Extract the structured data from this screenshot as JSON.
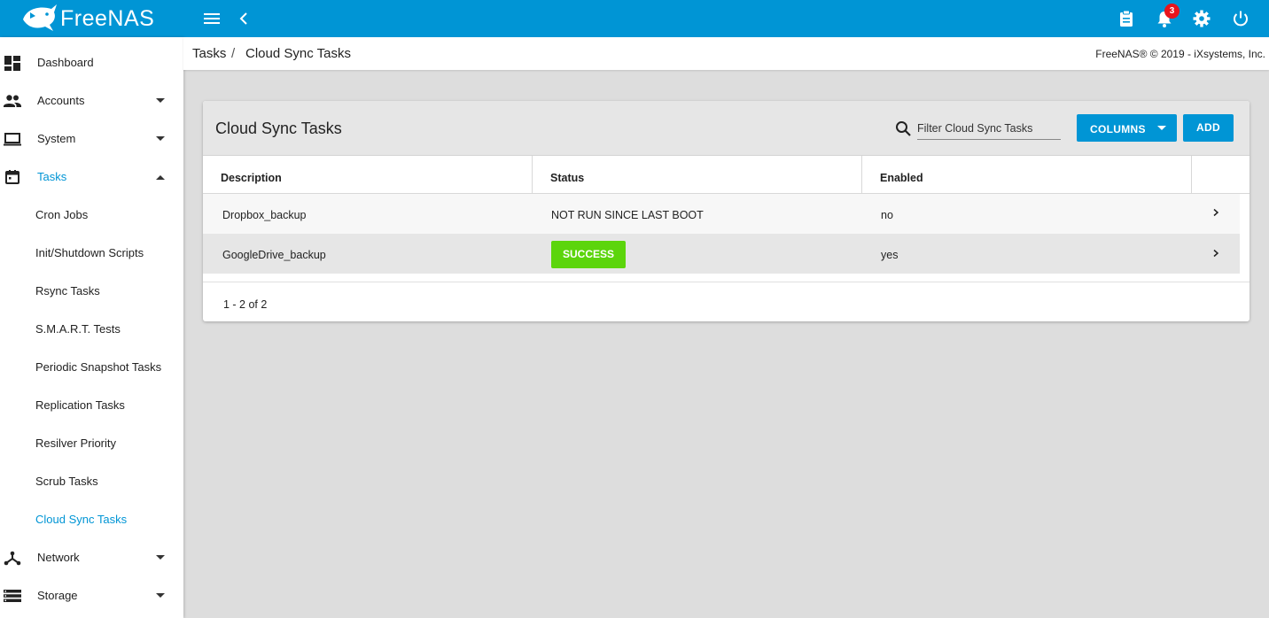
{
  "app": {
    "logo_text": "FreeNAS",
    "notification_count": "3",
    "accent_color": "#0095d5"
  },
  "sidebar": {
    "items": [
      {
        "label": "Dashboard",
        "icon": "dashboard-icon"
      },
      {
        "label": "Accounts",
        "icon": "people-icon"
      },
      {
        "label": "System",
        "icon": "laptop-icon"
      },
      {
        "label": "Tasks",
        "icon": "calendar-icon"
      },
      {
        "label": "Network",
        "icon": "network-icon"
      },
      {
        "label": "Storage",
        "icon": "storage-icon"
      }
    ],
    "task_subitems": [
      "Cron Jobs",
      "Init/Shutdown Scripts",
      "Rsync Tasks",
      "S.M.A.R.T. Tests",
      "Periodic Snapshot Tasks",
      "Replication Tasks",
      "Resilver Priority",
      "Scrub Tasks",
      "Cloud Sync Tasks"
    ]
  },
  "breadcrumb": {
    "parent": "Tasks",
    "separator": "/",
    "current": "Cloud Sync Tasks"
  },
  "copyright": "FreeNAS® © 2019 - iXsystems, Inc.",
  "card": {
    "title": "Cloud Sync Tasks",
    "filter_placeholder": "Filter Cloud Sync Tasks",
    "columns_button": "COLUMNS",
    "add_button": "ADD",
    "headers": [
      "Description",
      "Status",
      "Enabled"
    ],
    "rows": [
      {
        "description": "Dropbox_backup",
        "status": "NOT RUN SINCE LAST BOOT",
        "enabled": "no"
      },
      {
        "description": "GoogleDrive_backup",
        "status": "SUCCESS",
        "enabled": "yes"
      }
    ],
    "success_color": "#5cd50c",
    "pagination": "1 - 2 of 2"
  }
}
